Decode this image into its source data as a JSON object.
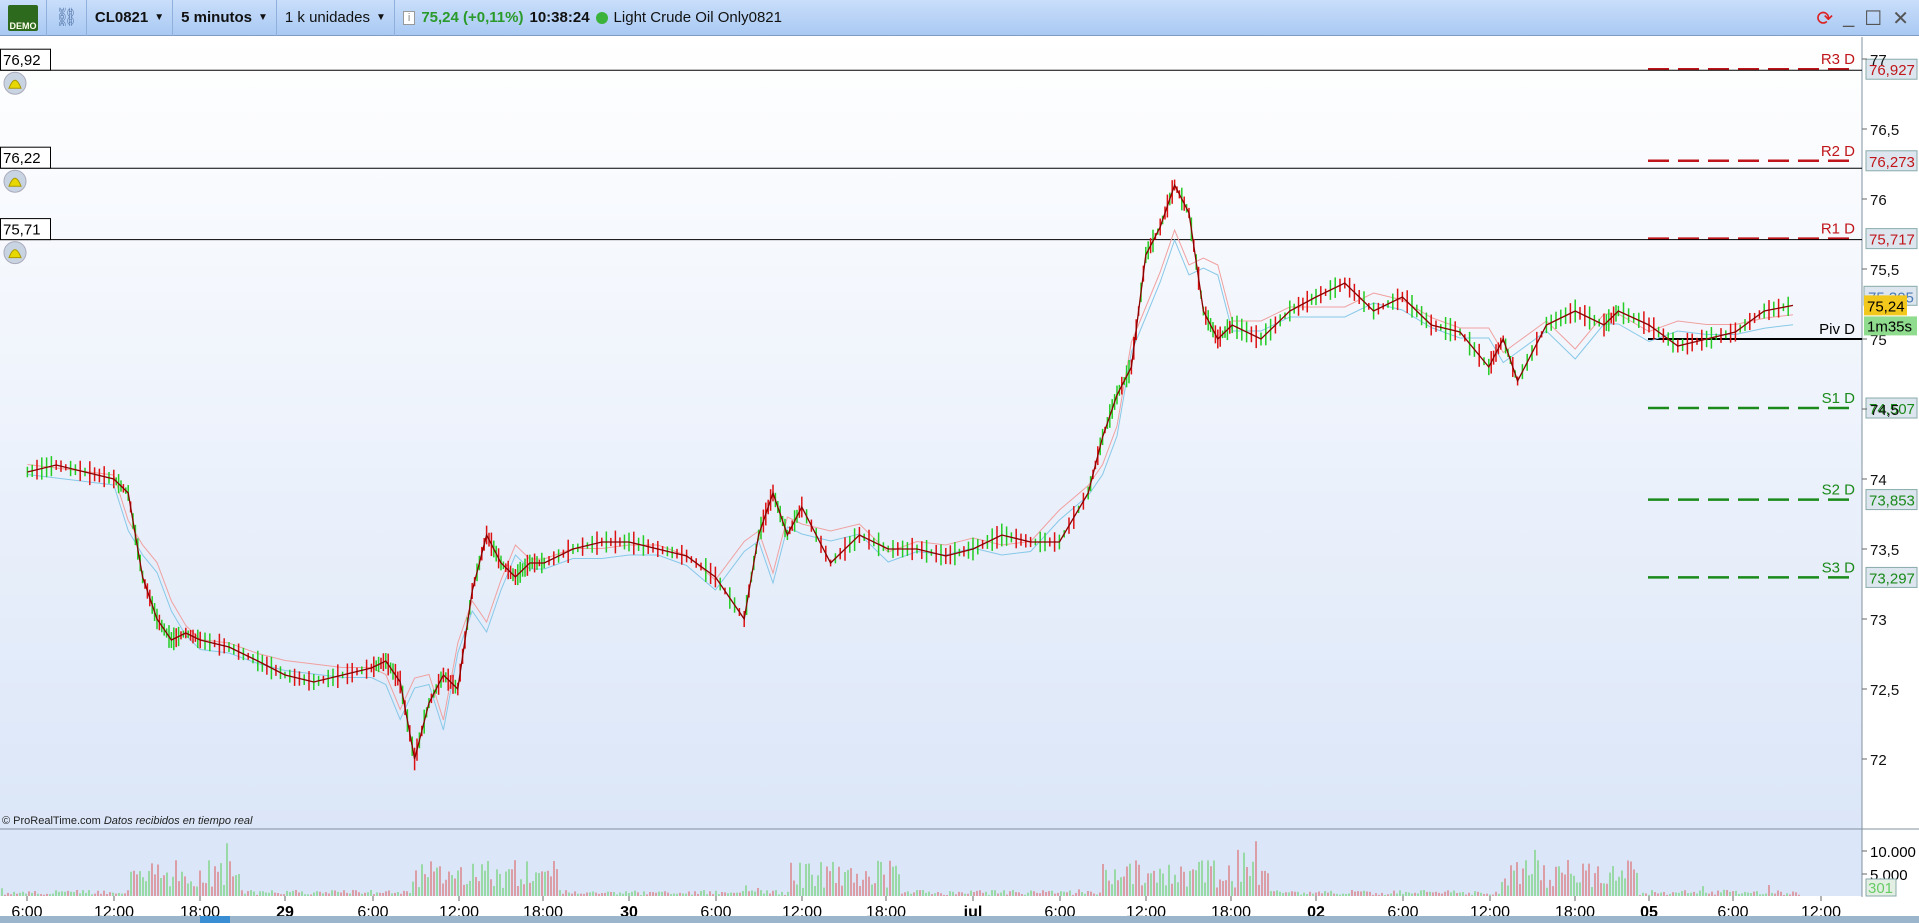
{
  "toolbar": {
    "demo_label": "DEMO",
    "symbol": "CL0821",
    "timeframe": "5 minutos",
    "units": "1 k unidades",
    "price": "75,24 (+0,11%)",
    "time": "10:38:24",
    "instrument": "Light Crude Oil Only0821"
  },
  "alerts": [
    {
      "value": "76,92",
      "price": 76.92
    },
    {
      "value": "76,22",
      "price": 76.22
    },
    {
      "value": "75,71",
      "price": 75.71
    }
  ],
  "pivots": [
    {
      "label": "R3 D",
      "value": "76,927",
      "price": 76.927,
      "color": "#c0161b"
    },
    {
      "label": "R2 D",
      "value": "76,273",
      "price": 76.273,
      "color": "#c0161b"
    },
    {
      "label": "R1 D",
      "value": "75,717",
      "price": 75.717,
      "color": "#c0161b"
    },
    {
      "label": "Piv D",
      "value": "",
      "price": 75.0,
      "color": "#000000"
    },
    {
      "label": "S1 D",
      "value": "74,507",
      "price": 74.507,
      "color": "#1a8a1a"
    },
    {
      "label": "S2 D",
      "value": "73,853",
      "price": 73.853,
      "color": "#1a8a1a"
    },
    {
      "label": "S3 D",
      "value": "73,297",
      "price": 73.297,
      "color": "#1a8a1a"
    }
  ],
  "price_axis": {
    "ticks": [
      "77",
      "76,5",
      "76",
      "75,5",
      "75",
      "74,5",
      "74",
      "73,5",
      "73",
      "72,5",
      "72"
    ],
    "current": "75,24",
    "countdown": "1m35s",
    "cloud_value": "75,305"
  },
  "volume_axis": {
    "ticks": [
      "10.000",
      "5.000"
    ],
    "current": "301"
  },
  "footer": {
    "copyright": "© ProRealTime.com",
    "status": "Datos recibidos en tiempo real"
  },
  "chart_data": {
    "type": "line",
    "x_ticks": [
      [
        "6:00",
        false
      ],
      [
        "12:00",
        false
      ],
      [
        "18:00",
        false
      ],
      [
        "29",
        true
      ],
      [
        "6:00",
        false
      ],
      [
        "12:00",
        false
      ],
      [
        "18:00",
        false
      ],
      [
        "30",
        true
      ],
      [
        "6:00",
        false
      ],
      [
        "12:00",
        false
      ],
      [
        "18:00",
        false
      ],
      [
        "jul",
        true
      ],
      [
        "6:00",
        false
      ],
      [
        "12:00",
        false
      ],
      [
        "18:00",
        false
      ],
      [
        "02",
        true
      ],
      [
        "6:00",
        false
      ],
      [
        "12:00",
        false
      ],
      [
        "18:00",
        false
      ],
      [
        "05",
        true
      ],
      [
        "6:00",
        false
      ],
      [
        "12:00",
        false
      ]
    ],
    "ylim": [
      71.6,
      77.1
    ],
    "series": [
      {
        "points": [
          [
            "28",
            6,
            74.05
          ],
          [
            "28",
            8,
            74.1
          ],
          [
            "28",
            10,
            74.05
          ],
          [
            "28",
            12,
            74.0
          ],
          [
            "28",
            13,
            73.9
          ],
          [
            "28",
            14,
            73.3
          ],
          [
            "28",
            15,
            73.0
          ],
          [
            "28",
            16,
            72.85
          ],
          [
            "28",
            17,
            72.9
          ],
          [
            "28",
            18,
            72.85
          ],
          [
            "28",
            20,
            72.8
          ],
          [
            "28",
            22,
            72.7
          ],
          [
            "29",
            0,
            72.6
          ],
          [
            "29",
            2,
            72.55
          ],
          [
            "29",
            4,
            72.6
          ],
          [
            "29",
            6,
            72.65
          ],
          [
            "29",
            7,
            72.7
          ],
          [
            "29",
            8,
            72.55
          ],
          [
            "29",
            9,
            72.0
          ],
          [
            "29",
            10,
            72.4
          ],
          [
            "29",
            11,
            72.6
          ],
          [
            "29",
            12,
            72.5
          ],
          [
            "29",
            13,
            73.2
          ],
          [
            "29",
            14,
            73.6
          ],
          [
            "29",
            15,
            73.4
          ],
          [
            "29",
            16,
            73.3
          ],
          [
            "29",
            17,
            73.4
          ],
          [
            "29",
            18,
            73.4
          ],
          [
            "29",
            20,
            73.5
          ],
          [
            "29",
            22,
            73.55
          ],
          [
            "30",
            0,
            73.55
          ],
          [
            "30",
            2,
            73.5
          ],
          [
            "30",
            4,
            73.45
          ],
          [
            "30",
            6,
            73.3
          ],
          [
            "30",
            8,
            73.0
          ],
          [
            "30",
            9,
            73.6
          ],
          [
            "30",
            10,
            73.9
          ],
          [
            "30",
            11,
            73.6
          ],
          [
            "30",
            12,
            73.8
          ],
          [
            "30",
            14,
            73.4
          ],
          [
            "30",
            16,
            73.6
          ],
          [
            "30",
            18,
            73.5
          ],
          [
            "30",
            20,
            73.5
          ],
          [
            "30",
            22,
            73.45
          ],
          [
            "jul",
            0,
            73.5
          ],
          [
            "jul",
            2,
            73.6
          ],
          [
            "jul",
            4,
            73.55
          ],
          [
            "jul",
            6,
            73.55
          ],
          [
            "jul",
            8,
            73.9
          ],
          [
            "jul",
            9,
            74.3
          ],
          [
            "jul",
            10,
            74.6
          ],
          [
            "jul",
            11,
            74.8
          ],
          [
            "jul",
            12,
            75.6
          ],
          [
            "jul",
            13,
            75.8
          ],
          [
            "jul",
            14,
            76.1
          ],
          [
            "jul",
            15,
            75.9
          ],
          [
            "jul",
            16,
            75.2
          ],
          [
            "jul",
            17,
            75.0
          ],
          [
            "jul",
            18,
            75.1
          ],
          [
            "jul",
            20,
            75.0
          ],
          [
            "jul",
            22,
            75.2
          ],
          [
            "02",
            0,
            75.3
          ],
          [
            "02",
            2,
            75.4
          ],
          [
            "02",
            4,
            75.2
          ],
          [
            "02",
            6,
            75.3
          ],
          [
            "02",
            8,
            75.1
          ],
          [
            "02",
            10,
            75.05
          ],
          [
            "02",
            12,
            74.8
          ],
          [
            "02",
            13,
            75.0
          ],
          [
            "02",
            14,
            74.7
          ],
          [
            "02",
            16,
            75.1
          ],
          [
            "02",
            18,
            75.2
          ],
          [
            "02",
            20,
            75.1
          ],
          [
            "02",
            21,
            75.2
          ],
          [
            "05",
            0,
            75.1
          ],
          [
            "05",
            2,
            74.95
          ],
          [
            "05",
            4,
            75.0
          ],
          [
            "05",
            6,
            75.05
          ],
          [
            "05",
            8,
            75.2
          ],
          [
            "05",
            10,
            75.24
          ]
        ]
      }
    ]
  },
  "colors": {
    "price_line": "#8b0000",
    "up": "#22cc22",
    "down": "#dd1111",
    "cloud": "#87c8e8"
  }
}
